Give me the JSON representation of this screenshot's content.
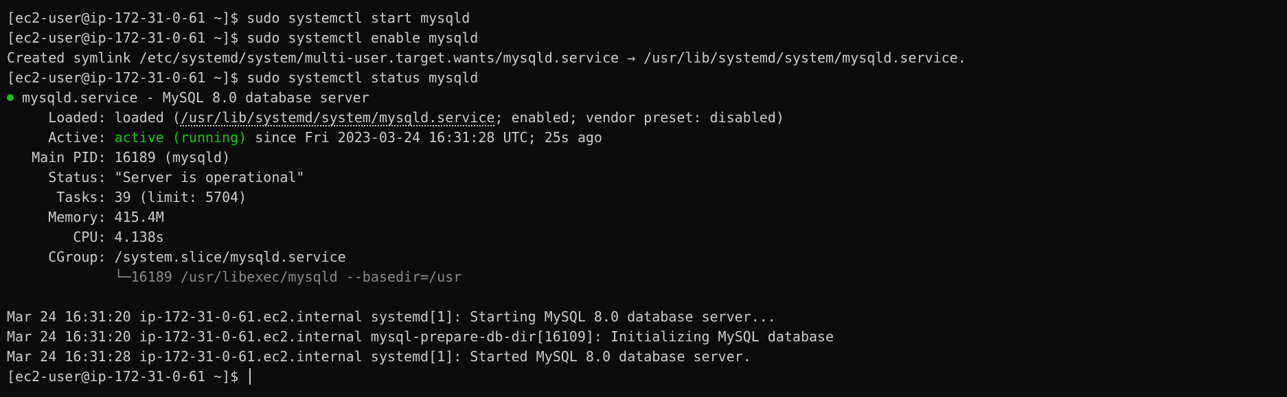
{
  "terminal": {
    "prompt": "[ec2-user@ip-172-31-0-61 ~]$ ",
    "lines": [
      {
        "cmd": "sudo systemctl start mysqld"
      },
      {
        "cmd": "sudo systemctl enable mysqld"
      },
      {
        "text": "Created symlink /etc/systemd/system/multi-user.target.wants/mysqld.service → /usr/lib/systemd/system/mysqld.service."
      },
      {
        "cmd": "sudo systemctl status mysqld"
      }
    ],
    "status": {
      "unit_line": "mysqld.service - MySQL 8.0 database server",
      "loaded_label": "     Loaded: ",
      "loaded_prefix": "loaded (",
      "loaded_path": "/usr/lib/systemd/system/mysqld.service",
      "loaded_suffix": "; enabled; vendor preset: disabled)",
      "active_label": "     Active: ",
      "active_state": "active (running)",
      "active_since": " since Fri 2023-03-24 16:31:28 UTC; 25s ago",
      "main_pid": "   Main PID: 16189 (mysqld)",
      "status_line": "     Status: \"Server is operational\"",
      "tasks": "      Tasks: 39 (limit: 5704)",
      "memory": "     Memory: 415.4M",
      "cpu": "        CPU: 4.138s",
      "cgroup": "     CGroup: /system.slice/mysqld.service",
      "cgroup_tree_prefix": "             └─",
      "cgroup_tree_proc": "16189 /usr/libexec/mysqld --basedir=/usr"
    },
    "journal": [
      "Mar 24 16:31:20 ip-172-31-0-61.ec2.internal systemd[1]: Starting MySQL 8.0 database server...",
      "Mar 24 16:31:20 ip-172-31-0-61.ec2.internal mysql-prepare-db-dir[16109]: Initializing MySQL database",
      "Mar 24 16:31:28 ip-172-31-0-61.ec2.internal systemd[1]: Started MySQL 8.0 database server."
    ],
    "colors": {
      "background": "#0c0c0c",
      "foreground": "#cccccc",
      "active_green": "#16c60c",
      "dim_gray": "#8a8a8a"
    }
  }
}
